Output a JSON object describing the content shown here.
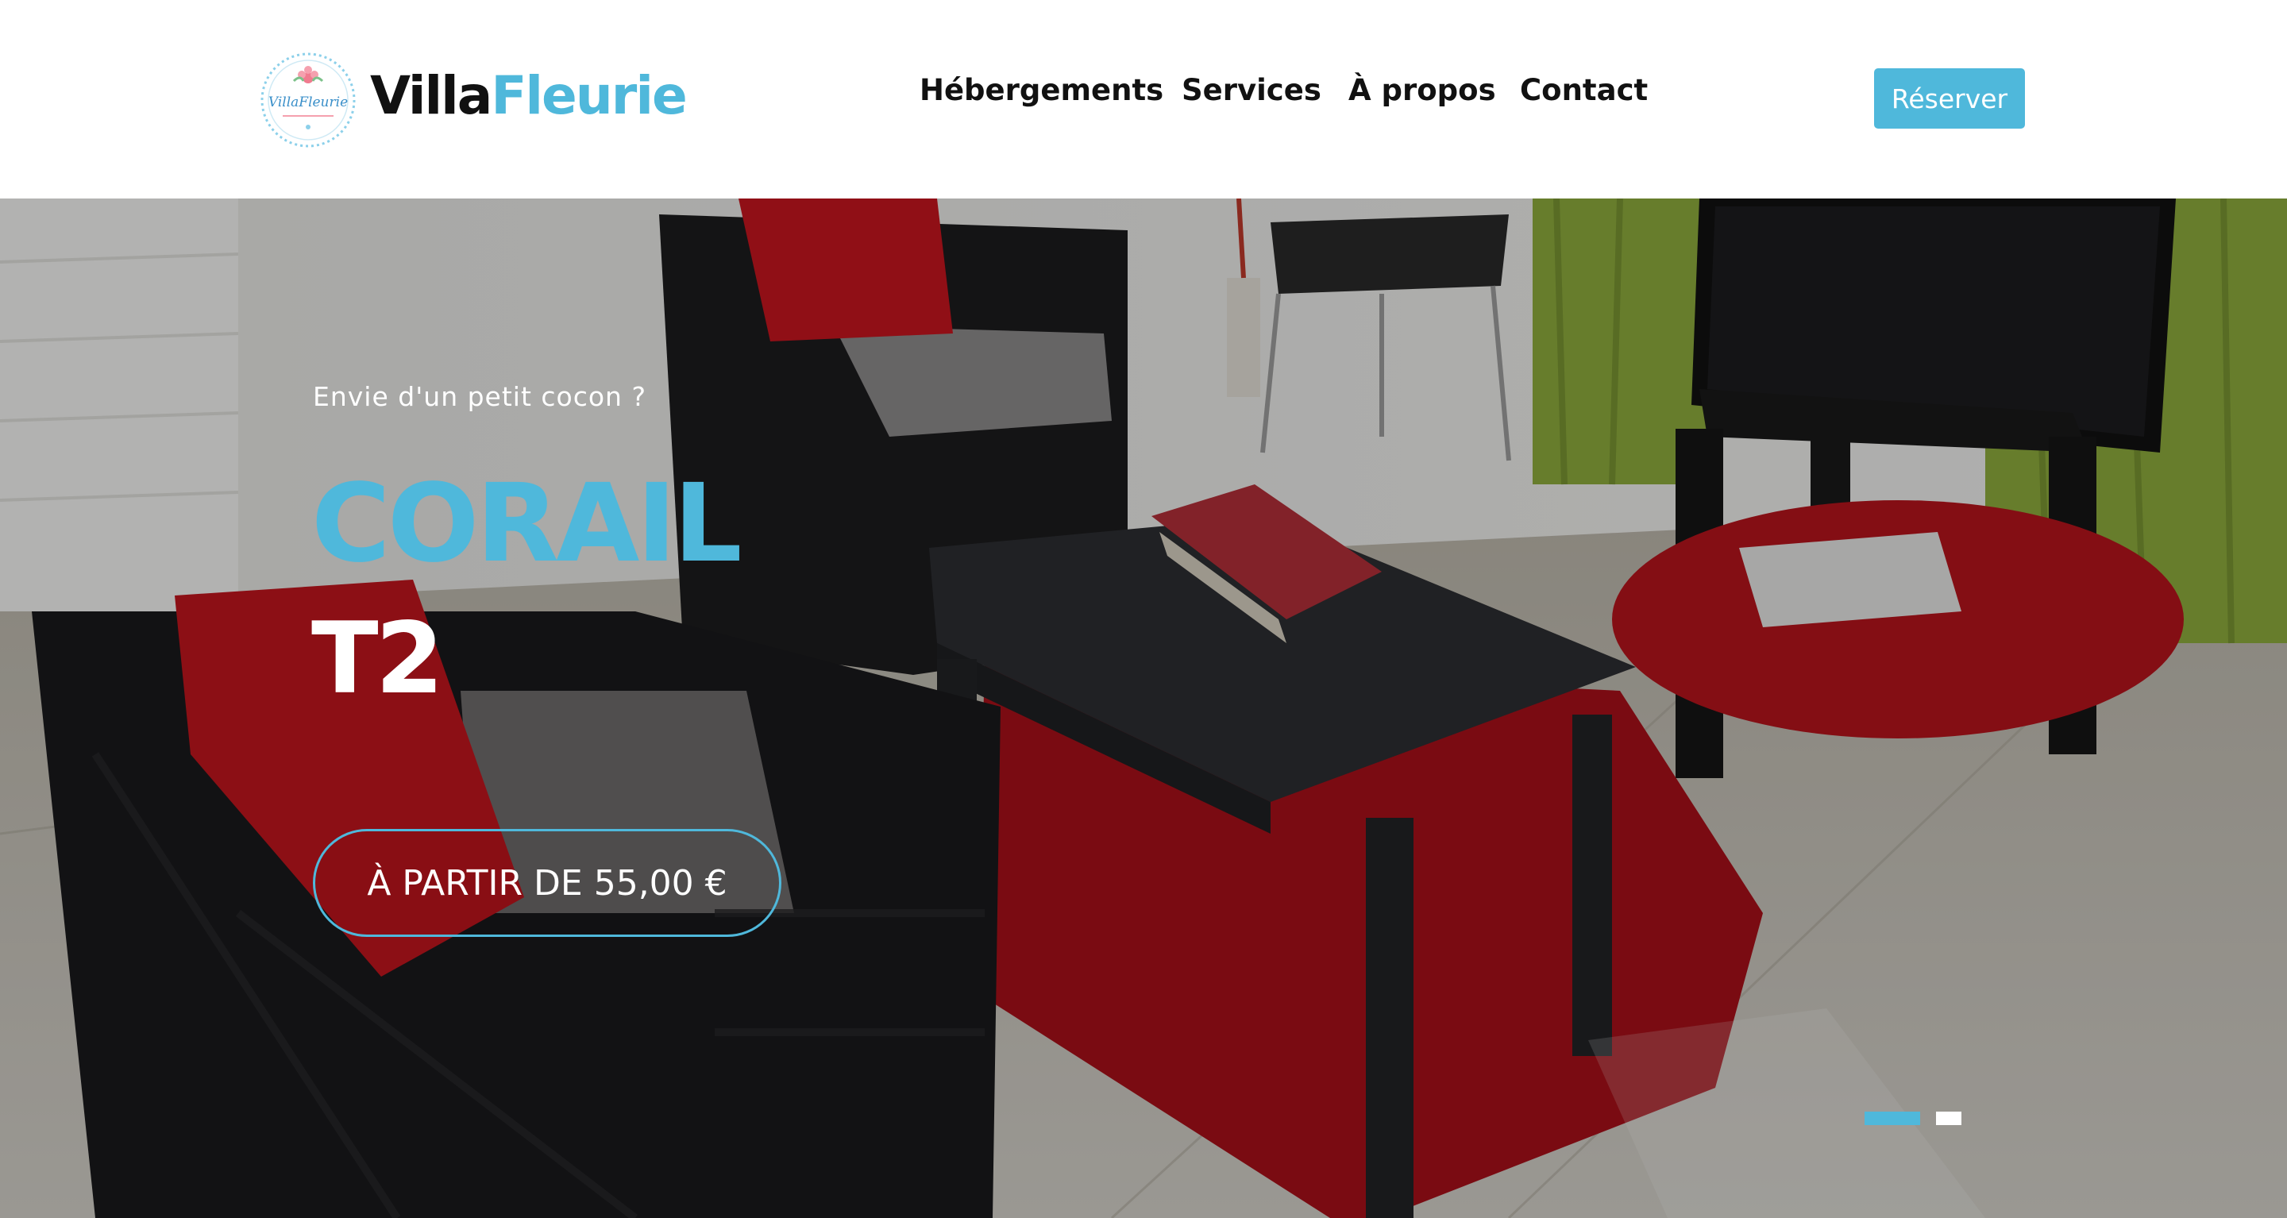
{
  "brand": {
    "logo_part1": "Villa",
    "logo_part2": "Fleurie",
    "emblem_text": "VillaFleurie",
    "accent_color": "#4fb8db"
  },
  "nav": {
    "items": [
      {
        "label": "Hébergements"
      },
      {
        "label": "Services"
      },
      {
        "label": "À propos"
      },
      {
        "label": "Contact"
      }
    ],
    "reserve_label": "Réserver"
  },
  "hero": {
    "kicker": "Envie d'un petit cocon ?",
    "title": "CORAIL",
    "subtitle": "T2",
    "price_label": "À PARTIR DE 55,00 €",
    "slides_total": 2,
    "active_slide": 1
  }
}
